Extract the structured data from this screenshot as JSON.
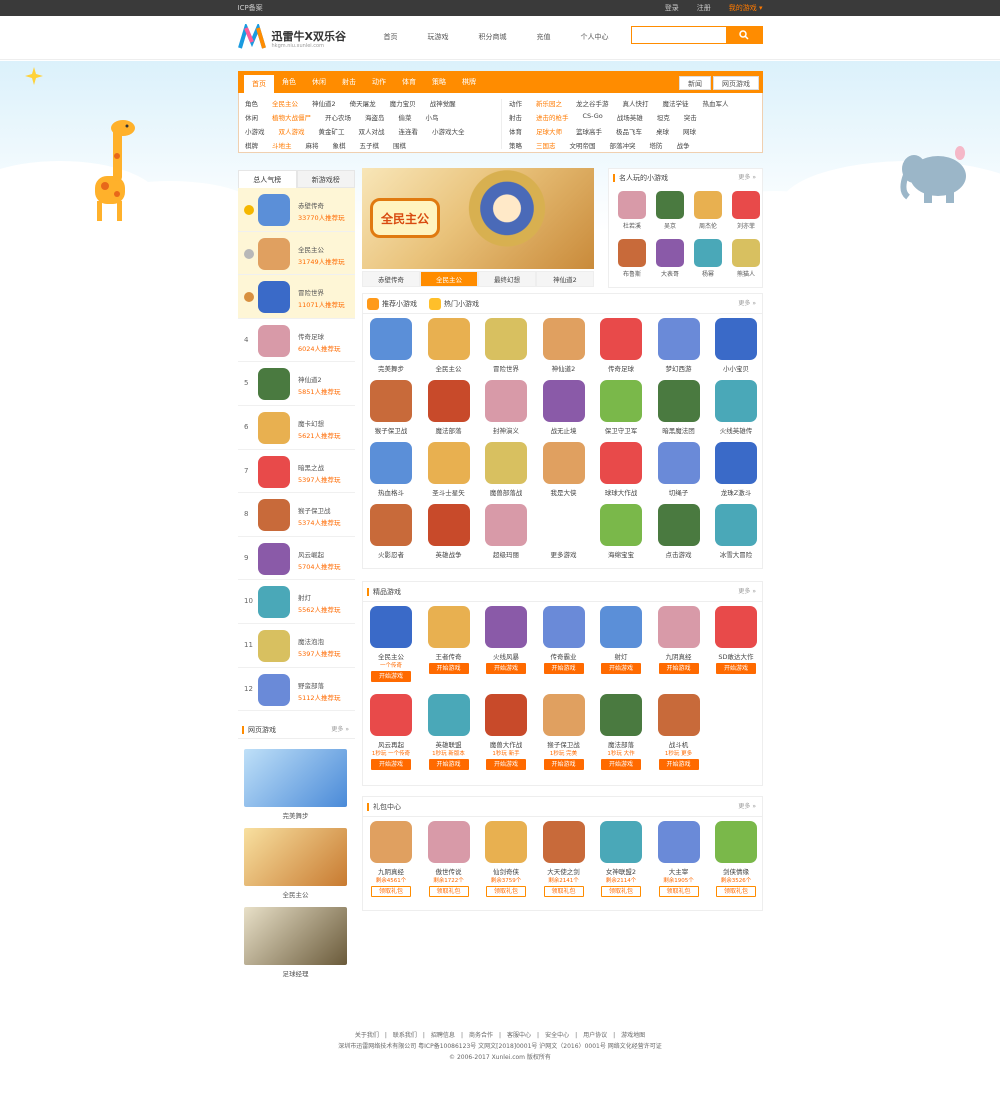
{
  "topbar": {
    "left": "ICP备案",
    "login": "登录",
    "register": "注册",
    "user": "我的游戏 ▾"
  },
  "header": {
    "logo_title": "迅雷牛X双乐谷",
    "logo_sub": "hkgm.niu.xunlei.com",
    "nav": [
      "首页",
      "玩游戏",
      "积分商城",
      "充值",
      "个人中心"
    ],
    "search_placeholder": ""
  },
  "catbar": {
    "tabs": [
      "首页",
      "角色",
      "休闲",
      "射击",
      "动作",
      "体育",
      "策略",
      "棋牌"
    ],
    "right1": "新闻",
    "right2": "网页游戏"
  },
  "cats": {
    "row1a": [
      "角色",
      "全民主公",
      "神仙道2",
      "倚天屠龙",
      "魔力宝贝",
      "战神觉醒"
    ],
    "row1b": [
      "动作",
      "新乐园之",
      "龙之谷手游",
      "真人快打",
      "魔法学徒",
      "热血军人"
    ],
    "row2a": [
      "休闲",
      "植物大战僵尸",
      "开心农场",
      "海盗岛",
      "偷菜",
      "小鸟"
    ],
    "row2b": [
      "射击",
      "进击的枪手",
      "CS-Go",
      "战场英雄",
      "坦克",
      "突击"
    ],
    "row3a": [
      "小游戏",
      "双人游戏",
      "黄金矿工",
      "双人对战",
      "连连看",
      "小游戏大全"
    ],
    "row3b": [
      "体育",
      "足球大师",
      "篮球高手",
      "极品飞车",
      "桌球",
      "网球"
    ],
    "row4a": [
      "棋牌",
      "斗地主",
      "麻将",
      "象棋",
      "五子棋",
      "围棋"
    ],
    "row4b": [
      "策略",
      "三国志",
      "文明帝国",
      "部落冲突",
      "塔防",
      "战争"
    ]
  },
  "ranking": {
    "tab1": "总人气榜",
    "tab2": "新游戏榜",
    "items": [
      {
        "num": "",
        "name": "赤壁传奇",
        "plays": "33770人推荐玩"
      },
      {
        "num": "",
        "name": "全民主公",
        "plays": "31749人推荐玩"
      },
      {
        "num": "",
        "name": "冒险世界",
        "plays": "11071人推荐玩"
      },
      {
        "num": "4",
        "name": "传奇足球",
        "plays": "6024人推荐玩"
      },
      {
        "num": "5",
        "name": "神仙道2",
        "plays": "5851人推荐玩"
      },
      {
        "num": "6",
        "name": "魔卡幻想",
        "plays": "5621人推荐玩"
      },
      {
        "num": "7",
        "name": "暗黑之战",
        "plays": "5397人推荐玩"
      },
      {
        "num": "8",
        "name": "猴子保卫战",
        "plays": "5374人推荐玩"
      },
      {
        "num": "9",
        "name": "风云崛起",
        "plays": "5704人推荐玩"
      },
      {
        "num": "10",
        "name": "射灯",
        "plays": "5562人推荐玩"
      },
      {
        "num": "11",
        "name": "魔法泡泡",
        "plays": "5397人推荐玩"
      },
      {
        "num": "12",
        "name": "野蛮部落",
        "plays": "5112人推荐玩"
      }
    ]
  },
  "webgames": {
    "title": "网页游戏",
    "more": "更多 »",
    "items": [
      {
        "name": "完美舞步"
      },
      {
        "name": "全民主公"
      },
      {
        "name": "足球经理"
      }
    ]
  },
  "banner": {
    "tabs": [
      "赤壁传奇",
      "全民主公",
      "最终幻想",
      "神仙道2"
    ],
    "logo_text": "全民主公"
  },
  "stars": {
    "title": "名人玩的小游戏",
    "more": "更多 »",
    "items": [
      {
        "name": "杜若溪"
      },
      {
        "name": "吴京"
      },
      {
        "name": "周杰伦"
      },
      {
        "name": "刘亦菲"
      },
      {
        "name": "布鲁斯"
      },
      {
        "name": "大表哥"
      },
      {
        "name": "杨幂"
      },
      {
        "name": "熊猫人"
      }
    ]
  },
  "smallgames": {
    "tab1": "推荐小游戏",
    "tab2": "热门小游戏",
    "more": "更多 »",
    "items": [
      {
        "name": "完美舞步"
      },
      {
        "name": "全民主公"
      },
      {
        "name": "冒险世界"
      },
      {
        "name": "神仙道2"
      },
      {
        "name": "传奇足球"
      },
      {
        "name": "梦幻西游"
      },
      {
        "name": "小小宝贝"
      },
      {
        "name": "猴子保卫战"
      },
      {
        "name": "魔法部落"
      },
      {
        "name": "封神演义"
      },
      {
        "name": "战无止境"
      },
      {
        "name": "保卫守卫军"
      },
      {
        "name": "暗黑魔法团"
      },
      {
        "name": "火线英雄传"
      },
      {
        "name": "热血格斗"
      },
      {
        "name": "圣斗士星矢"
      },
      {
        "name": "魔兽部落战"
      },
      {
        "name": "我是大侠"
      },
      {
        "name": "球球大作战"
      },
      {
        "name": "切绳子"
      },
      {
        "name": "龙珠Z激斗"
      },
      {
        "name": "火影忍者"
      },
      {
        "name": "英雄战争"
      },
      {
        "name": "超级玛丽"
      },
      {
        "name": "更多游戏"
      },
      {
        "name": "海绵宝宝"
      },
      {
        "name": "点击游戏"
      },
      {
        "name": "冰雪大冒险"
      }
    ],
    "more_label": "更多游戏"
  },
  "boutique": {
    "title": "精品游戏",
    "more": "更多 »",
    "btn": "开始游戏",
    "row1": [
      {
        "name": "全民主公",
        "sub": "一个传奇"
      },
      {
        "name": "王者传奇",
        "sub": ""
      },
      {
        "name": "火线风暴",
        "sub": ""
      },
      {
        "name": "传奇霸业",
        "sub": ""
      },
      {
        "name": "射灯",
        "sub": ""
      },
      {
        "name": "九阴真经",
        "sub": ""
      },
      {
        "name": "SD敢达大作",
        "sub": ""
      }
    ],
    "row2": [
      {
        "name": "风云再起",
        "sub": "1秒玩 一个传奇"
      },
      {
        "name": "英雄联盟",
        "sub": "1秒玩 新版本"
      },
      {
        "name": "魔兽大作战",
        "sub": "1秒玩 新手"
      },
      {
        "name": "猴子保卫战",
        "sub": "1秒玩 完美"
      },
      {
        "name": "魔法部落",
        "sub": "1秒玩 大作"
      },
      {
        "name": "战斗机",
        "sub": "1秒玩 更多"
      }
    ]
  },
  "gifts": {
    "title": "礼包中心",
    "more": "更多 »",
    "btn": "领取礼包",
    "items": [
      {
        "name": "九阴真经",
        "left": "剩余4561个"
      },
      {
        "name": "傲世传说",
        "left": "剩余1722个"
      },
      {
        "name": "仙剑奇侠",
        "left": "剩余3759个"
      },
      {
        "name": "大天使之剑",
        "left": "剩余2141个"
      },
      {
        "name": "女神联盟2",
        "left": "剩余2114个"
      },
      {
        "name": "大主宰",
        "left": "剩余1905个"
      },
      {
        "name": "剑侠情缘",
        "left": "剩余3526个"
      }
    ]
  },
  "footer": {
    "links": [
      "关于我们",
      "联系我们",
      "招聘信息",
      "商务合作",
      "客服中心",
      "安全中心",
      "用户协议",
      "游戏地图"
    ],
    "line2": "深圳市迅雷网络技术有限公司 粤ICP备10086123号 文网文[2018]0001号 沪网文（2016）0001号 网络文化经营许可证",
    "line3": "© 2006-2017 Xunlei.com 版权所有"
  },
  "colors": {
    "accent": "#ff8c00",
    "topbar": "#3a3a3a"
  }
}
